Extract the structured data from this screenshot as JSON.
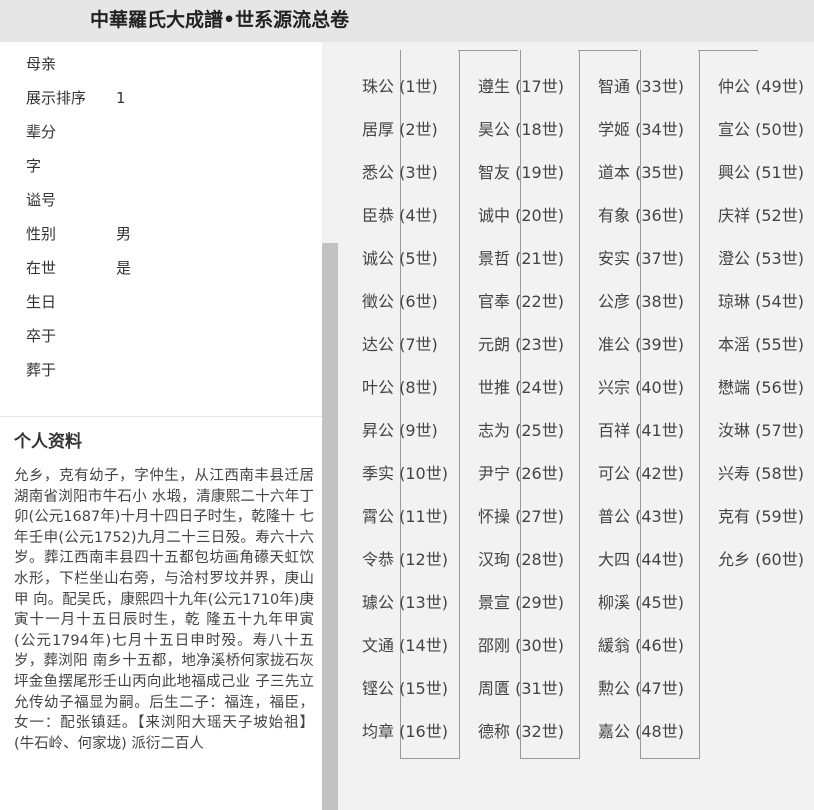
{
  "header": {
    "title": "中華羅氏大成譜•世系源流总卷"
  },
  "info": [
    {
      "key": "母亲",
      "value": ""
    },
    {
      "key": "展示排序",
      "value": "1"
    },
    {
      "key": "辈分",
      "value": ""
    },
    {
      "key": "字",
      "value": ""
    },
    {
      "key": "谥号",
      "value": ""
    },
    {
      "key": "性别",
      "value": "男"
    },
    {
      "key": "在世",
      "value": "是"
    },
    {
      "key": "生日",
      "value": ""
    },
    {
      "key": "卒于",
      "value": ""
    },
    {
      "key": "葬于",
      "value": ""
    }
  ],
  "profile": {
    "title": "个人资料",
    "bio": "允乡，克有幼子，字仲生，从江西南丰县迁居湖南省浏阳市牛石小 水塅，清康熙二十六年丁卯(公元1687年)十月十四日子时生，乾隆十 七年壬申(公元1752)九月二十三日殁。寿六十六岁。葬江西南丰县四十五都包坊画角礤天虹饮水形，下栏坐山右旁，与洽村罗坟并界，庚山甲 向。配吴氏，康熙四十九年(公元1710年)庚寅十一月十五日辰时生，乾 隆五十九年甲寅(公元1794年)七月十五日申时殁。寿八十五岁，葬浏阳 南乡十五都，地净溪桥何家拢石灰坪金鱼摆尾形壬山丙向此地福成己业 子三先立允传幼子福显为嗣。后生二子：福连，福臣，女一：配张镇廷。【来浏阳大瑶天子坡始祖】(牛石岭、何家垅) 派衍二百人"
  },
  "generations": [
    [
      "珠公 (1世)",
      "居厚 (2世)",
      "悉公 (3世)",
      "臣恭 (4世)",
      "诚公 (5世)",
      "徵公 (6世)",
      "达公 (7世)",
      "叶公 (8世)",
      "昇公 (9世)",
      "季实 (10世)",
      "霄公 (11世)",
      "令恭 (12世)",
      "璩公 (13世)",
      "文通 (14世)",
      "铿公 (15世)",
      "均章 (16世)"
    ],
    [
      "遵生 (17世)",
      "昊公 (18世)",
      "智友 (19世)",
      "诚中 (20世)",
      "景哲 (21世)",
      "官奉 (22世)",
      "元朗 (23世)",
      "世推 (24世)",
      "志为 (25世)",
      "尹宁 (26世)",
      "怀操 (27世)",
      "汉珣 (28世)",
      "景宣 (29世)",
      "邵刚 (30世)",
      "周匱 (31世)",
      "德称 (32世)"
    ],
    [
      "智通 (33世)",
      "学姬 (34世)",
      "道本 (35世)",
      "有象 (36世)",
      "安实 (37世)",
      "公彦 (38世)",
      "准公 (39世)",
      "兴宗 (40世)",
      "百祥 (41世)",
      "可公 (42世)",
      "普公 (43世)",
      "大四 (44世)",
      "柳溪 (45世)",
      "緩翁 (46世)",
      "勲公 (47世)",
      "嘉公 (48世)"
    ],
    [
      "仲公 (49世)",
      "宣公 (50世)",
      "興公 (51世)",
      "庆祥 (52世)",
      "澄公 (53世)",
      "琼琳 (54世)",
      "本滛 (55世)",
      "懋端 (56世)",
      "汝琳 (57世)",
      "兴寿 (58世)",
      "克有 (59世)",
      "允乡 (60世)"
    ]
  ]
}
